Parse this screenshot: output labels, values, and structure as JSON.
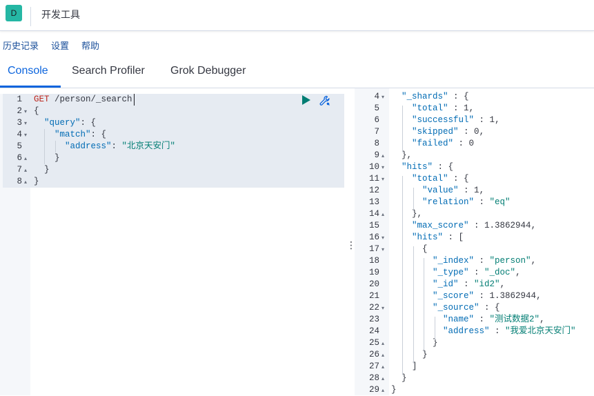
{
  "header": {
    "app_badge": "D",
    "title": "开发工具"
  },
  "menu": {
    "history": "历史记录",
    "settings": "设置",
    "help": "帮助"
  },
  "tabs": [
    "Console",
    "Search Profiler",
    "Grok Debugger"
  ],
  "request": {
    "lines": [
      {
        "n": "1",
        "fold": "",
        "tokens": [
          [
            "method",
            "GET"
          ],
          [
            "path",
            " /person/_search"
          ]
        ]
      },
      {
        "n": "2",
        "fold": "▾",
        "tokens": [
          [
            "punc",
            "{"
          ]
        ]
      },
      {
        "n": "3",
        "fold": "▾",
        "tokens": [
          [
            "punc",
            "  "
          ],
          [
            "key",
            "\"query\""
          ],
          [
            "punc",
            ": {"
          ]
        ]
      },
      {
        "n": "4",
        "fold": "▾",
        "tokens": [
          [
            "punc",
            "    "
          ],
          [
            "key",
            "\"match\""
          ],
          [
            "punc",
            ": {"
          ]
        ]
      },
      {
        "n": "5",
        "fold": "",
        "tokens": [
          [
            "punc",
            "      "
          ],
          [
            "key",
            "\"address\""
          ],
          [
            "punc",
            ": "
          ],
          [
            "str",
            "\"北京天安门\""
          ]
        ]
      },
      {
        "n": "6",
        "fold": "▴",
        "tokens": [
          [
            "punc",
            "    }"
          ]
        ]
      },
      {
        "n": "7",
        "fold": "▴",
        "tokens": [
          [
            "punc",
            "  }"
          ]
        ]
      },
      {
        "n": "8",
        "fold": "▴",
        "tokens": [
          [
            "punc",
            "}"
          ]
        ]
      }
    ]
  },
  "response": {
    "lines": [
      {
        "n": "4",
        "fold": "▾",
        "tokens": [
          [
            "punc",
            "  "
          ],
          [
            "key",
            "\"_shards\""
          ],
          [
            "punc",
            " : {"
          ]
        ]
      },
      {
        "n": "5",
        "fold": "",
        "tokens": [
          [
            "punc",
            "    "
          ],
          [
            "key",
            "\"total\""
          ],
          [
            "punc",
            " : "
          ],
          [
            "num",
            "1"
          ],
          [
            "punc",
            ","
          ]
        ]
      },
      {
        "n": "6",
        "fold": "",
        "tokens": [
          [
            "punc",
            "    "
          ],
          [
            "key",
            "\"successful\""
          ],
          [
            "punc",
            " : "
          ],
          [
            "num",
            "1"
          ],
          [
            "punc",
            ","
          ]
        ]
      },
      {
        "n": "7",
        "fold": "",
        "tokens": [
          [
            "punc",
            "    "
          ],
          [
            "key",
            "\"skipped\""
          ],
          [
            "punc",
            " : "
          ],
          [
            "num",
            "0"
          ],
          [
            "punc",
            ","
          ]
        ]
      },
      {
        "n": "8",
        "fold": "",
        "tokens": [
          [
            "punc",
            "    "
          ],
          [
            "key",
            "\"failed\""
          ],
          [
            "punc",
            " : "
          ],
          [
            "num",
            "0"
          ]
        ]
      },
      {
        "n": "9",
        "fold": "▴",
        "tokens": [
          [
            "punc",
            "  },"
          ]
        ]
      },
      {
        "n": "10",
        "fold": "▾",
        "tokens": [
          [
            "punc",
            "  "
          ],
          [
            "key",
            "\"hits\""
          ],
          [
            "punc",
            " : {"
          ]
        ]
      },
      {
        "n": "11",
        "fold": "▾",
        "tokens": [
          [
            "punc",
            "    "
          ],
          [
            "key",
            "\"total\""
          ],
          [
            "punc",
            " : {"
          ]
        ]
      },
      {
        "n": "12",
        "fold": "",
        "tokens": [
          [
            "punc",
            "      "
          ],
          [
            "key",
            "\"value\""
          ],
          [
            "punc",
            " : "
          ],
          [
            "num",
            "1"
          ],
          [
            "punc",
            ","
          ]
        ]
      },
      {
        "n": "13",
        "fold": "",
        "tokens": [
          [
            "punc",
            "      "
          ],
          [
            "key",
            "\"relation\""
          ],
          [
            "punc",
            " : "
          ],
          [
            "str",
            "\"eq\""
          ]
        ]
      },
      {
        "n": "14",
        "fold": "▴",
        "tokens": [
          [
            "punc",
            "    },"
          ]
        ]
      },
      {
        "n": "15",
        "fold": "",
        "tokens": [
          [
            "punc",
            "    "
          ],
          [
            "key",
            "\"max_score\""
          ],
          [
            "punc",
            " : "
          ],
          [
            "num",
            "1.3862944"
          ],
          [
            "punc",
            ","
          ]
        ]
      },
      {
        "n": "16",
        "fold": "▾",
        "tokens": [
          [
            "punc",
            "    "
          ],
          [
            "key",
            "\"hits\""
          ],
          [
            "punc",
            " : ["
          ]
        ]
      },
      {
        "n": "17",
        "fold": "▾",
        "tokens": [
          [
            "punc",
            "      {"
          ]
        ]
      },
      {
        "n": "18",
        "fold": "",
        "tokens": [
          [
            "punc",
            "        "
          ],
          [
            "key",
            "\"_index\""
          ],
          [
            "punc",
            " : "
          ],
          [
            "str",
            "\"person\""
          ],
          [
            "punc",
            ","
          ]
        ]
      },
      {
        "n": "19",
        "fold": "",
        "tokens": [
          [
            "punc",
            "        "
          ],
          [
            "key",
            "\"_type\""
          ],
          [
            "punc",
            " : "
          ],
          [
            "str",
            "\"_doc\""
          ],
          [
            "punc",
            ","
          ]
        ]
      },
      {
        "n": "20",
        "fold": "",
        "tokens": [
          [
            "punc",
            "        "
          ],
          [
            "key",
            "\"_id\""
          ],
          [
            "punc",
            " : "
          ],
          [
            "str",
            "\"id2\""
          ],
          [
            "punc",
            ","
          ]
        ]
      },
      {
        "n": "21",
        "fold": "",
        "tokens": [
          [
            "punc",
            "        "
          ],
          [
            "key",
            "\"_score\""
          ],
          [
            "punc",
            " : "
          ],
          [
            "num",
            "1.3862944"
          ],
          [
            "punc",
            ","
          ]
        ]
      },
      {
        "n": "22",
        "fold": "▾",
        "tokens": [
          [
            "punc",
            "        "
          ],
          [
            "key",
            "\"_source\""
          ],
          [
            "punc",
            " : {"
          ]
        ]
      },
      {
        "n": "23",
        "fold": "",
        "tokens": [
          [
            "punc",
            "          "
          ],
          [
            "key",
            "\"name\""
          ],
          [
            "punc",
            " : "
          ],
          [
            "str",
            "\"测试数据2\""
          ],
          [
            "punc",
            ","
          ]
        ]
      },
      {
        "n": "24",
        "fold": "",
        "tokens": [
          [
            "punc",
            "          "
          ],
          [
            "key",
            "\"address\""
          ],
          [
            "punc",
            " : "
          ],
          [
            "str",
            "\"我爱北京天安门\""
          ]
        ]
      },
      {
        "n": "25",
        "fold": "▴",
        "tokens": [
          [
            "punc",
            "        }"
          ]
        ]
      },
      {
        "n": "26",
        "fold": "▴",
        "tokens": [
          [
            "punc",
            "      }"
          ]
        ]
      },
      {
        "n": "27",
        "fold": "▴",
        "tokens": [
          [
            "punc",
            "    ]"
          ]
        ]
      },
      {
        "n": "28",
        "fold": "▴",
        "tokens": [
          [
            "punc",
            "  }"
          ]
        ]
      },
      {
        "n": "29",
        "fold": "▴",
        "tokens": [
          [
            "punc",
            "}"
          ]
        ]
      }
    ]
  },
  "icons": {
    "run": "play-icon",
    "settings": "wrench-icon"
  },
  "colors": {
    "accent": "#0b64dd",
    "badge": "#25b7a4",
    "key": "#006bb4",
    "string": "#017d73",
    "method": "#bd271e"
  }
}
